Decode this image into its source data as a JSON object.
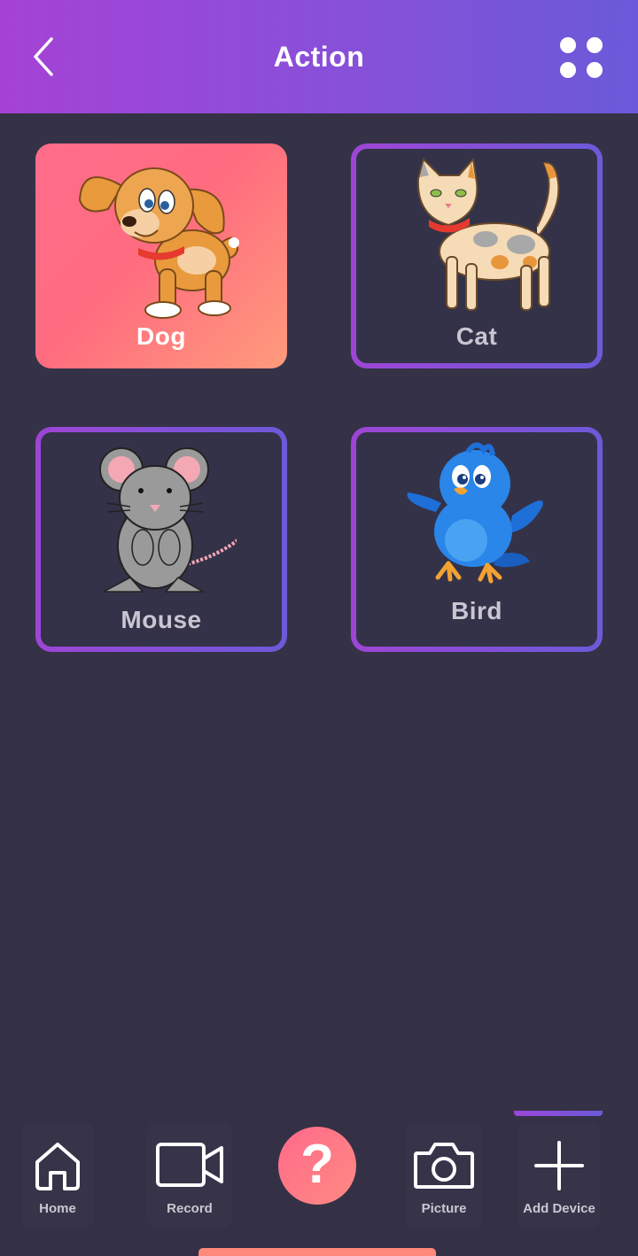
{
  "header": {
    "title": "Action",
    "gradient_start": "#a542d6",
    "gradient_end": "#6a5ad9",
    "back_icon": "chevron-left-icon",
    "menu_icon": "grid-dots-icon"
  },
  "cards": [
    {
      "label": "Dog",
      "icon": "dog-icon",
      "selected": true
    },
    {
      "label": "Cat",
      "icon": "cat-icon",
      "selected": false
    },
    {
      "label": "Mouse",
      "icon": "mouse-icon",
      "selected": false
    },
    {
      "label": "Bird",
      "icon": "bird-icon",
      "selected": false
    }
  ],
  "tabbar": {
    "tabs": [
      {
        "label": "Home",
        "icon": "home-icon"
      },
      {
        "label": "Record",
        "icon": "video-camera-icon"
      },
      {
        "label": "",
        "icon": "question-icon",
        "glyph": "?"
      },
      {
        "label": "Picture",
        "icon": "camera-icon"
      },
      {
        "label": "Add Device",
        "icon": "plus-icon",
        "active": true
      }
    ]
  },
  "colors": {
    "background": "#353248",
    "selected_card": "#ff6b7f",
    "card_outline": "#8a4fd8",
    "help_button": "#ff6a8a"
  }
}
